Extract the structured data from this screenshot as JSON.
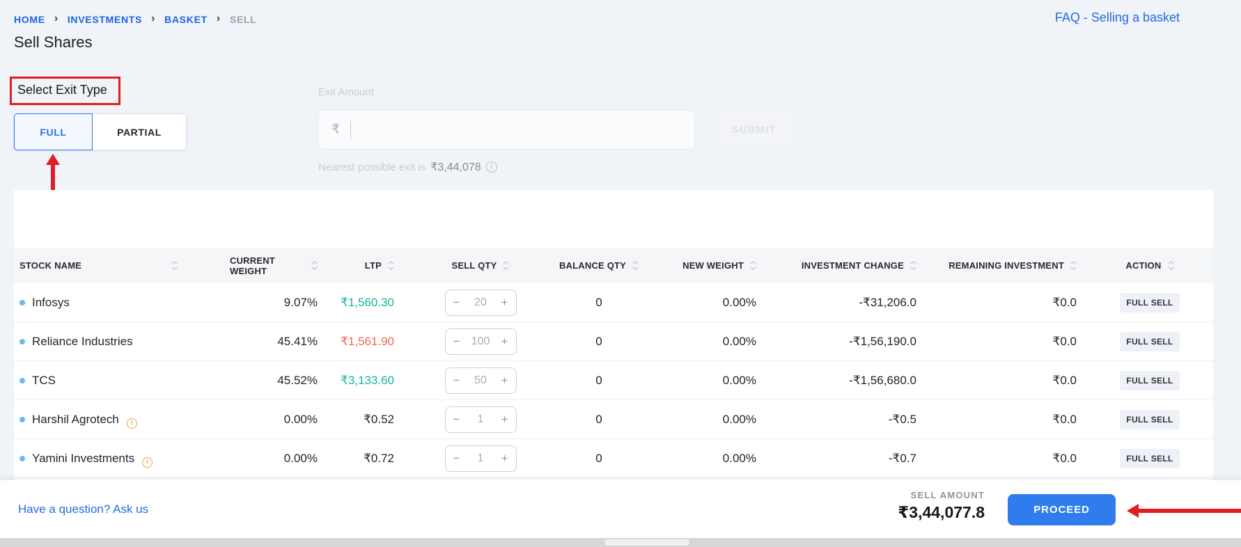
{
  "breadcrumb": {
    "separator": "›",
    "items": [
      {
        "label": "HOME"
      },
      {
        "label": "INVESTMENTS"
      },
      {
        "label": "BASKET"
      },
      {
        "label": "SELL"
      }
    ]
  },
  "faq_link": "FAQ - Selling a basket",
  "page_title": "Sell Shares",
  "exit_type": {
    "label": "Select Exit Type",
    "options": [
      {
        "label": "FULL",
        "selected": true
      },
      {
        "label": "PARTIAL",
        "selected": false
      }
    ]
  },
  "exit_amount": {
    "label": "Exit Amount",
    "currency": "₹",
    "value": "",
    "submit_label": "SUBMIT",
    "hint_prefix": "Nearest possible exit is",
    "hint_amount": "₹3,44,078",
    "info_glyph": "i"
  },
  "stepper": {
    "minus": "−",
    "plus": "+"
  },
  "warning_glyph": "!",
  "table": {
    "columns": [
      "STOCK NAME",
      "CURRENT WEIGHT",
      "LTP",
      "SELL QTY",
      "BALANCE QTY",
      "NEW WEIGHT",
      "INVESTMENT CHANGE",
      "REMAINING INVESTMENT",
      "ACTION"
    ],
    "rows": [
      {
        "stock": "Infosys",
        "warning": false,
        "current_weight": "9.07%",
        "ltp": "₹1,560.30",
        "ltp_trend": "up",
        "sell_qty": "20",
        "balance_qty": "0",
        "new_weight": "0.00%",
        "investment_change": "-₹31,206.0",
        "remaining_investment": "₹0.0",
        "action": "FULL SELL"
      },
      {
        "stock": "Reliance Industries",
        "warning": false,
        "current_weight": "45.41%",
        "ltp": "₹1,561.90",
        "ltp_trend": "down",
        "sell_qty": "100",
        "balance_qty": "0",
        "new_weight": "0.00%",
        "investment_change": "-₹1,56,190.0",
        "remaining_investment": "₹0.0",
        "action": "FULL SELL"
      },
      {
        "stock": "TCS",
        "warning": false,
        "current_weight": "45.52%",
        "ltp": "₹3,133.60",
        "ltp_trend": "up",
        "sell_qty": "50",
        "balance_qty": "0",
        "new_weight": "0.00%",
        "investment_change": "-₹1,56,680.0",
        "remaining_investment": "₹0.0",
        "action": "FULL SELL"
      },
      {
        "stock": "Harshil Agrotech",
        "warning": true,
        "current_weight": "0.00%",
        "ltp": "₹0.52",
        "ltp_trend": "neutral",
        "sell_qty": "1",
        "balance_qty": "0",
        "new_weight": "0.00%",
        "investment_change": "-₹0.5",
        "remaining_investment": "₹0.0",
        "action": "FULL SELL"
      },
      {
        "stock": "Yamini Investments",
        "warning": true,
        "current_weight": "0.00%",
        "ltp": "₹0.72",
        "ltp_trend": "neutral",
        "sell_qty": "1",
        "balance_qty": "0",
        "new_weight": "0.00%",
        "investment_change": "-₹0.7",
        "remaining_investment": "₹0.0",
        "action": "FULL SELL"
      }
    ]
  },
  "footer": {
    "question_link": "Have a question? Ask us",
    "sell_amount_label": "SELL AMOUNT",
    "sell_amount_value": "₹3,44,077.8",
    "proceed_label": "PROCEED"
  },
  "colors": {
    "accent_blue": "#2e7ced",
    "link_blue": "#2569e6",
    "ltp_up_green": "#10b99a",
    "ltp_down_red": "#f4645c",
    "annotation_red": "#e01d25",
    "warning_orange": "#f2a33c",
    "page_background": "#f0f3f7"
  }
}
